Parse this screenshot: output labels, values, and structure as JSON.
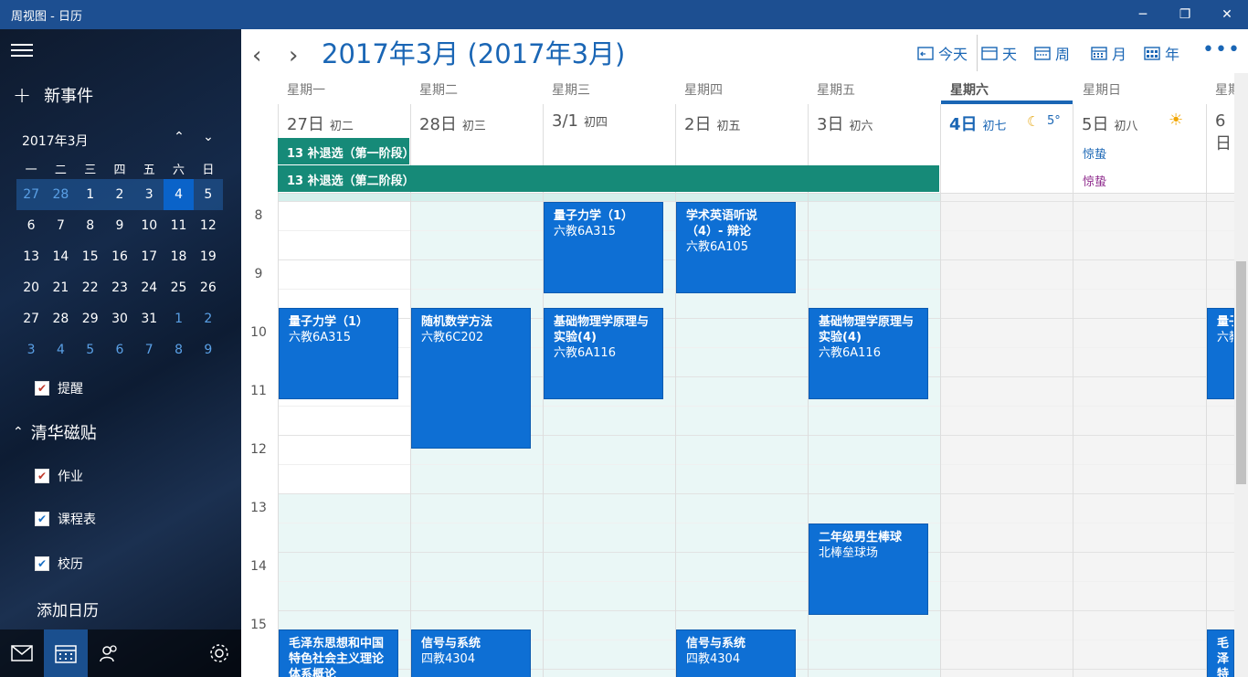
{
  "window": {
    "title": "周视图 - 日历",
    "minimize": "─",
    "restore": "❐",
    "close": "✕"
  },
  "sidebar": {
    "new_event": "新事件",
    "new_event_icon": "plus-icon",
    "mini_month": {
      "title": "2017年3月",
      "prev_glyph": "⌃",
      "next_glyph": "⌄",
      "weekdays": [
        "一",
        "二",
        "三",
        "四",
        "五",
        "六",
        "日"
      ],
      "weeks": [
        [
          "27",
          "28",
          "1",
          "2",
          "3",
          "4",
          "5"
        ],
        [
          "6",
          "7",
          "8",
          "9",
          "10",
          "11",
          "12"
        ],
        [
          "13",
          "14",
          "15",
          "16",
          "17",
          "18",
          "19"
        ],
        [
          "20",
          "21",
          "22",
          "23",
          "24",
          "25",
          "26"
        ],
        [
          "27",
          "28",
          "29",
          "30",
          "31",
          "1",
          "2"
        ],
        [
          "3",
          "4",
          "5",
          "6",
          "7",
          "8",
          "9"
        ]
      ]
    },
    "reminder": "提醒",
    "section_title": "清华磁贴",
    "calendars": [
      {
        "label": "作业",
        "color": "#c0392b",
        "check": "✔"
      },
      {
        "label": "课程表",
        "color": "#1a6fc4",
        "check": "✔"
      },
      {
        "label": "校历",
        "color": "#1a6fc4",
        "check": "✔"
      }
    ],
    "add_calendar": "添加日历",
    "bottom_icons": [
      "mail-icon",
      "calendar-icon",
      "people-icon",
      "settings-icon"
    ]
  },
  "header": {
    "title": "2017年3月 (2017年3月)",
    "prev": "‹",
    "next": "›",
    "today": "今天",
    "day": "天",
    "week": "周",
    "month": "月",
    "year": "年",
    "more": "•••"
  },
  "days": [
    {
      "weekday": "星期一",
      "num": "27日",
      "lunar": "初二"
    },
    {
      "weekday": "星期二",
      "num": "28日",
      "lunar": "初三"
    },
    {
      "weekday": "星期三",
      "num": "3/1",
      "lunar": "初四"
    },
    {
      "weekday": "星期四",
      "num": "2日",
      "lunar": "初五"
    },
    {
      "weekday": "星期五",
      "num": "3日",
      "lunar": "初六"
    },
    {
      "weekday": "星期六",
      "num": "4日",
      "lunar": "初七",
      "weather": "5°",
      "weather_icon": "moon-icon"
    },
    {
      "weekday": "星期日",
      "num": "5日",
      "lunar": "初八",
      "weather_icon": "sun-icon"
    },
    {
      "weekday": "星期一",
      "num": "6日",
      "lunar": ""
    }
  ],
  "allday": [
    {
      "label": "13 补退选（第一阶段）"
    },
    {
      "label": "13 补退选（第二阶段）"
    }
  ],
  "holidays": [
    {
      "label": "惊蛰",
      "color": "#1a66b5"
    },
    {
      "label": "惊蛰",
      "color": "#8e2a8c"
    }
  ],
  "hours": [
    "8",
    "9",
    "10",
    "11",
    "12",
    "13",
    "14",
    "15"
  ],
  "events": [
    {
      "title": "量子力学（1）",
      "location": "六教6A315"
    },
    {
      "title": "学术英语听说（4）- 辩论",
      "location": "六教6A105"
    },
    {
      "title": "量子力学（1）",
      "location": "六教6A315"
    },
    {
      "title": "随机数学方法",
      "location": "六教6C202"
    },
    {
      "title": "基础物理学原理与实验(4)",
      "location": "六教6A116"
    },
    {
      "title": "基础物理学原理与实验(4)",
      "location": "六教6A116"
    },
    {
      "title": "量子",
      "location": "六教"
    },
    {
      "title": "二年级男生棒球",
      "location": "北棒垒球场"
    },
    {
      "title": "毛泽东思想和中国特色社会主义理论体系概论",
      "location": ""
    },
    {
      "title": "信号与系统",
      "location": "四教4304"
    },
    {
      "title": "信号与系统",
      "location": "四教4304"
    },
    {
      "title": "毛泽特色",
      "location": ""
    }
  ]
}
